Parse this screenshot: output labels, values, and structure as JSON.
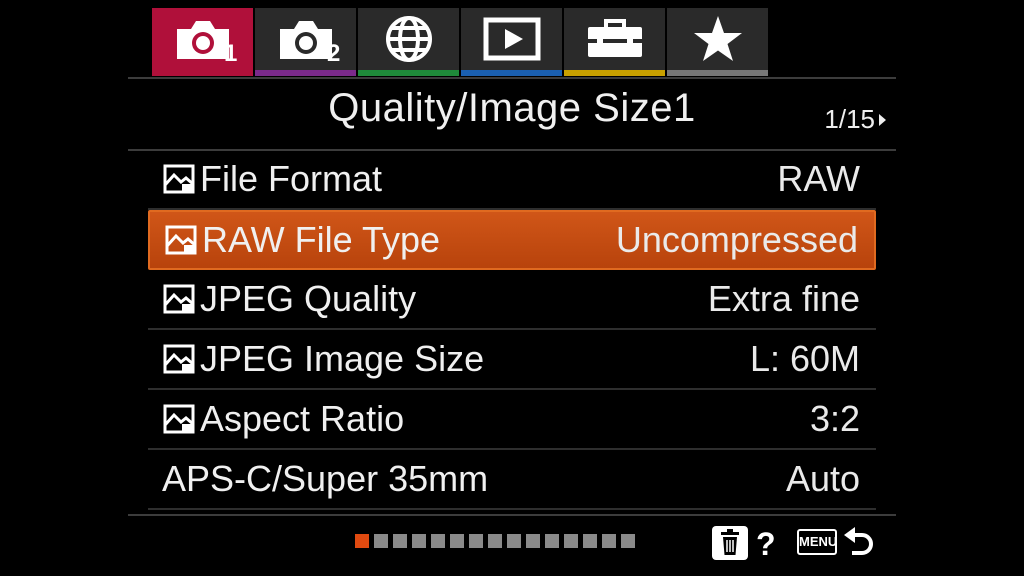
{
  "tabs": [
    {
      "icon": "camera-icon",
      "sub": "1",
      "color": "#b0103a",
      "active": true
    },
    {
      "icon": "camera-icon",
      "sub": "2",
      "color": "#7a2a8a",
      "active": false
    },
    {
      "icon": "globe-icon",
      "sub": "",
      "color": "#1f8a3a",
      "active": false
    },
    {
      "icon": "playback-icon",
      "sub": "",
      "color": "#1a5fb0",
      "active": false
    },
    {
      "icon": "toolbox-icon",
      "sub": "",
      "color": "#c8a000",
      "active": false
    },
    {
      "icon": "star-icon",
      "sub": "",
      "color": "#777777",
      "active": false
    }
  ],
  "header": {
    "title": "Quality/Image Size1",
    "page": "1/15"
  },
  "menu": {
    "items": [
      {
        "label": "File Format",
        "value": "RAW",
        "icon": "image-quality-icon",
        "selected": false
      },
      {
        "label": "RAW File Type",
        "value": "Uncompressed",
        "icon": "image-quality-icon",
        "selected": true
      },
      {
        "label": "JPEG Quality",
        "value": "Extra fine",
        "icon": "image-quality-icon",
        "selected": false
      },
      {
        "label": "JPEG Image Size",
        "value": "L: 60M",
        "icon": "image-quality-icon",
        "selected": false
      },
      {
        "label": "Aspect Ratio",
        "value": "3:2",
        "icon": "image-quality-icon",
        "selected": false
      },
      {
        "label": "APS-C/Super 35mm",
        "value": "Auto",
        "icon": "",
        "selected": false
      }
    ]
  },
  "footer": {
    "page_current": 1,
    "page_total": 15,
    "help_label": "?",
    "menu_label": "MENU",
    "accent": "#e04a10"
  }
}
